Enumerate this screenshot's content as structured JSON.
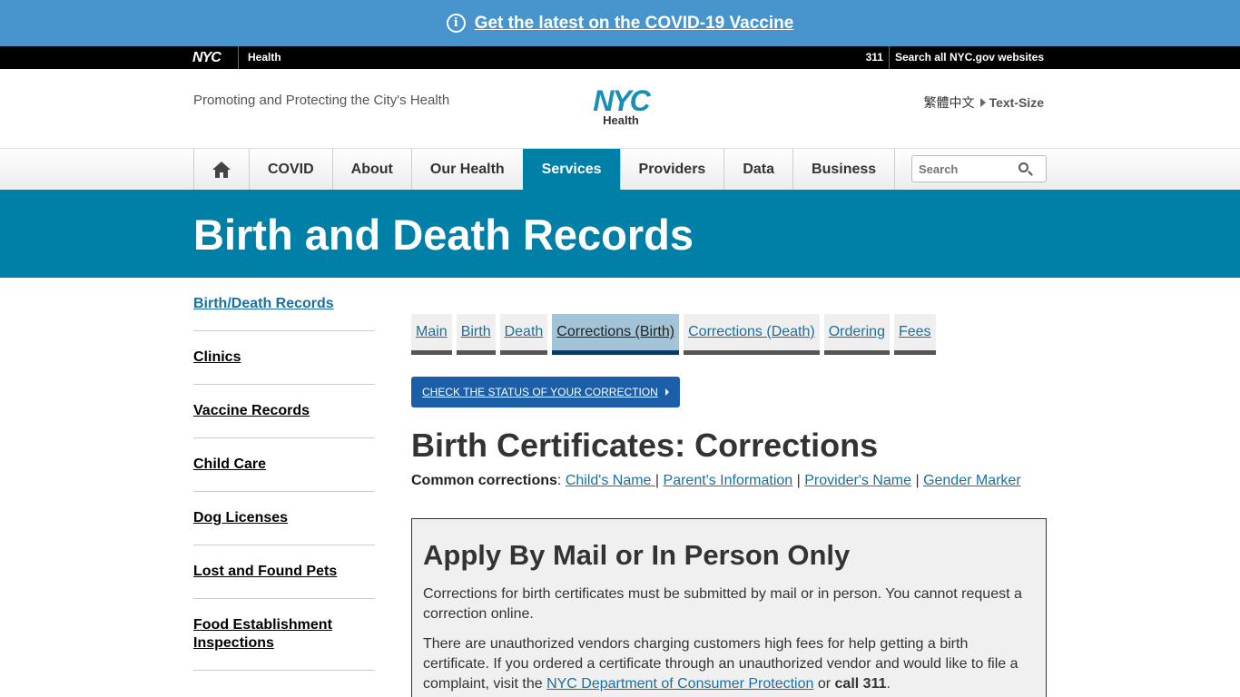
{
  "alert": {
    "text": "Get the latest on the COVID-19 Vaccine",
    "icon": "info-icon"
  },
  "topbar": {
    "logo": "NYC",
    "agency": "Health",
    "link_311": "311",
    "search_all": "Search all NYC.gov websites"
  },
  "header": {
    "tagline": "Promoting and Protecting the City's Health",
    "logo_nyc": "NYC",
    "logo_health": "Health",
    "language": "繁體中文",
    "text_size": "Text-Size"
  },
  "nav": {
    "items": [
      "COVID",
      "About",
      "Our Health",
      "Services",
      "Providers",
      "Data",
      "Business"
    ],
    "active": "Services",
    "search_placeholder": "Search"
  },
  "page": {
    "title": "Birth and Death Records"
  },
  "sidebar": {
    "items": [
      "Birth/Death Records",
      "Clinics",
      "Vaccine Records",
      "Child Care",
      "Dog Licenses",
      "Lost and Found Pets",
      "Food Establishment Inspections"
    ]
  },
  "tabs": [
    "Main",
    "Birth",
    "Death",
    "Corrections (Birth)",
    "Corrections (Death)",
    "Ordering",
    "Fees"
  ],
  "main": {
    "status_button": "CHECK THE STATUS OF YOUR CORRECTION",
    "heading": "Birth Certificates: Corrections",
    "common_label": "Common corrections",
    "common_links": [
      "Child's Name ",
      "Parent's Information",
      "Provider's Name",
      "Gender Marker"
    ],
    "box_heading": "Apply By Mail or In Person Only",
    "box_p1": "Corrections for birth certificates must be submitted by mail or in person. You cannot request a correction online.",
    "box_p2_pre": "There are unauthorized vendors charging customers high fees for help getting a birth certificate. If you ordered a certificate through an unauthorized vendor and would like to file a complaint, visit the ",
    "box_p2_link": "NYC Department of Consumer Protection",
    "box_p2_mid": " or ",
    "box_p2_bold": "call 311",
    "box_p2_end": "."
  }
}
